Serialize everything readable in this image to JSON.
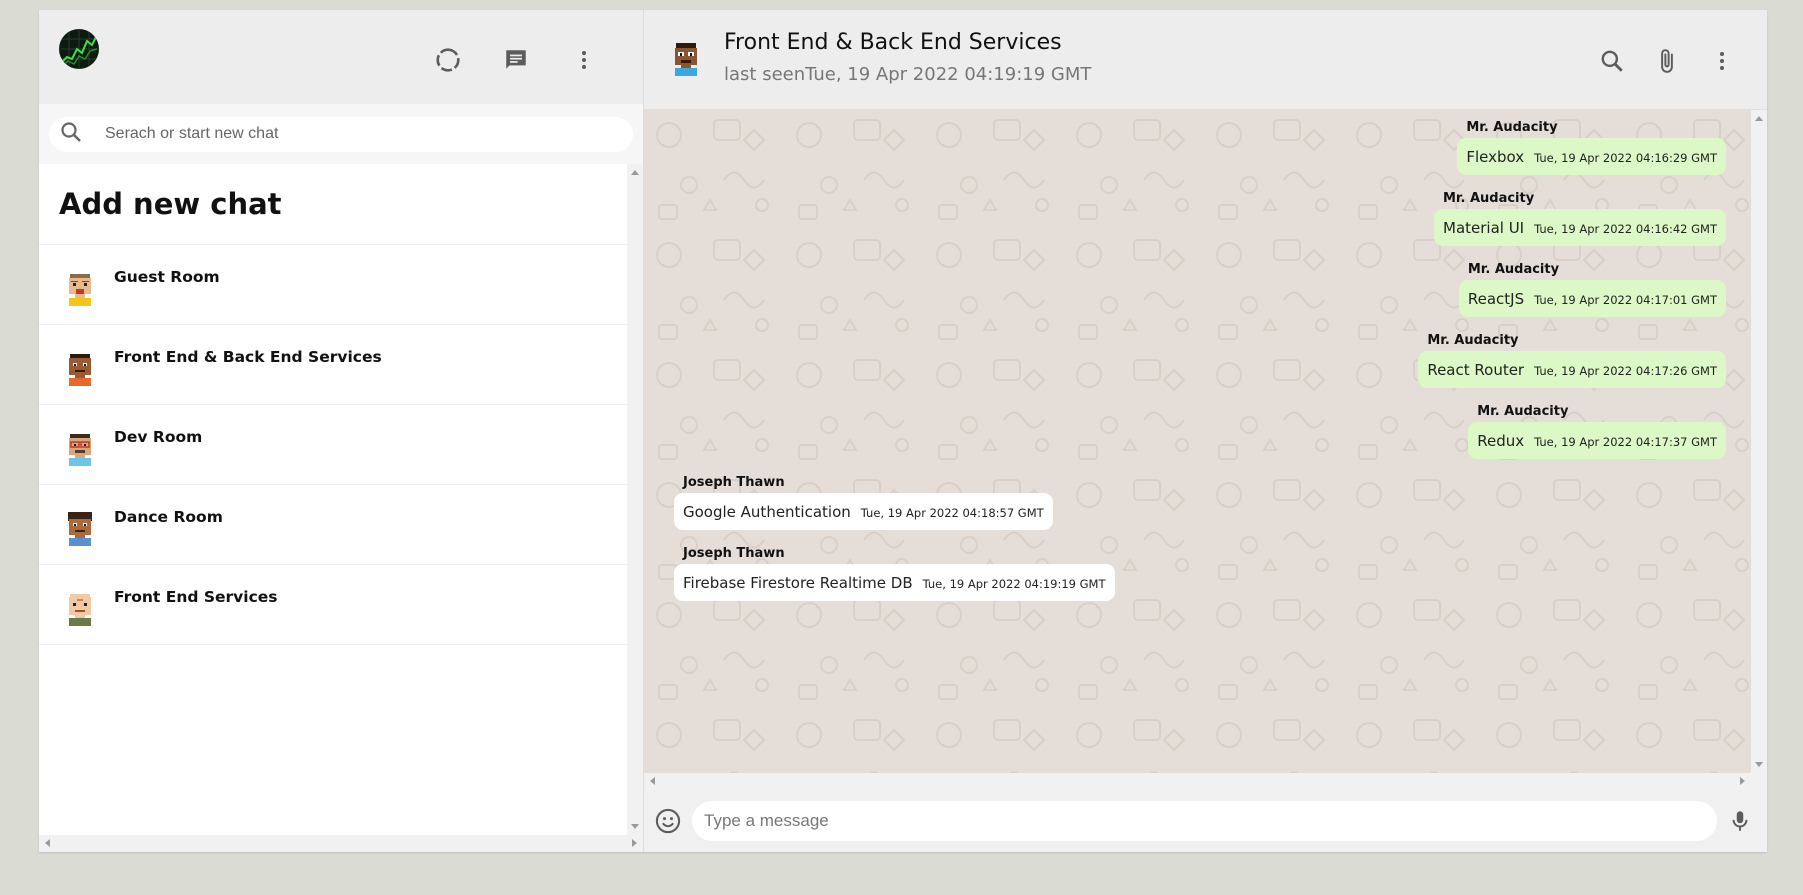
{
  "sidebar": {
    "search_placeholder": "Serach or start new chat",
    "add_new_chat": "Add new chat",
    "chats": [
      {
        "name": "Guest Room",
        "avatar_icon": "pixel-avatar-tan-red-beard-icon"
      },
      {
        "name": "Front End & Back End Services",
        "avatar_icon": "pixel-avatar-dark-orange-shirt-icon"
      },
      {
        "name": "Dev Room",
        "avatar_icon": "pixel-avatar-glasses-blue-shirt-icon"
      },
      {
        "name": "Dance Room",
        "avatar_icon": "pixel-avatar-curly-hair-icon"
      },
      {
        "name": "Front End Services",
        "avatar_icon": "pixel-avatar-bald-green-shirt-icon"
      }
    ]
  },
  "header": {
    "title": "Front End & Back End Services",
    "last_seen": "last seenTue, 19 Apr 2022 04:19:19 GMT"
  },
  "messages": [
    {
      "sender": "Mr. Audacity",
      "text": "Flexbox",
      "time": "Tue, 19 Apr 2022 04:16:29 GMT",
      "mine": true
    },
    {
      "sender": "Mr. Audacity",
      "text": "Material UI",
      "time": "Tue, 19 Apr 2022 04:16:42 GMT",
      "mine": true
    },
    {
      "sender": "Mr. Audacity",
      "text": "ReactJS",
      "time": "Tue, 19 Apr 2022 04:17:01 GMT",
      "mine": true
    },
    {
      "sender": "Mr. Audacity",
      "text": "React Router",
      "time": "Tue, 19 Apr 2022 04:17:26 GMT",
      "mine": true
    },
    {
      "sender": "Mr. Audacity",
      "text": "Redux",
      "time": "Tue, 19 Apr 2022 04:17:37 GMT",
      "mine": true
    },
    {
      "sender": "Joseph Thawn",
      "text": "Google Authentication",
      "time": "Tue, 19 Apr 2022 04:18:57 GMT",
      "mine": false
    },
    {
      "sender": "Joseph Thawn",
      "text": "Firebase Firestore Realtime DB",
      "time": "Tue, 19 Apr 2022 04:19:19 GMT",
      "mine": false
    }
  ],
  "footer": {
    "input_placeholder": "Type a message"
  },
  "colors": {
    "outgoing_bubble": "#dcf8c6",
    "incoming_bubble": "#ffffff",
    "chat_background": "#e5ded8",
    "header_bg": "#ededed",
    "page_bg": "#dadbd3"
  }
}
